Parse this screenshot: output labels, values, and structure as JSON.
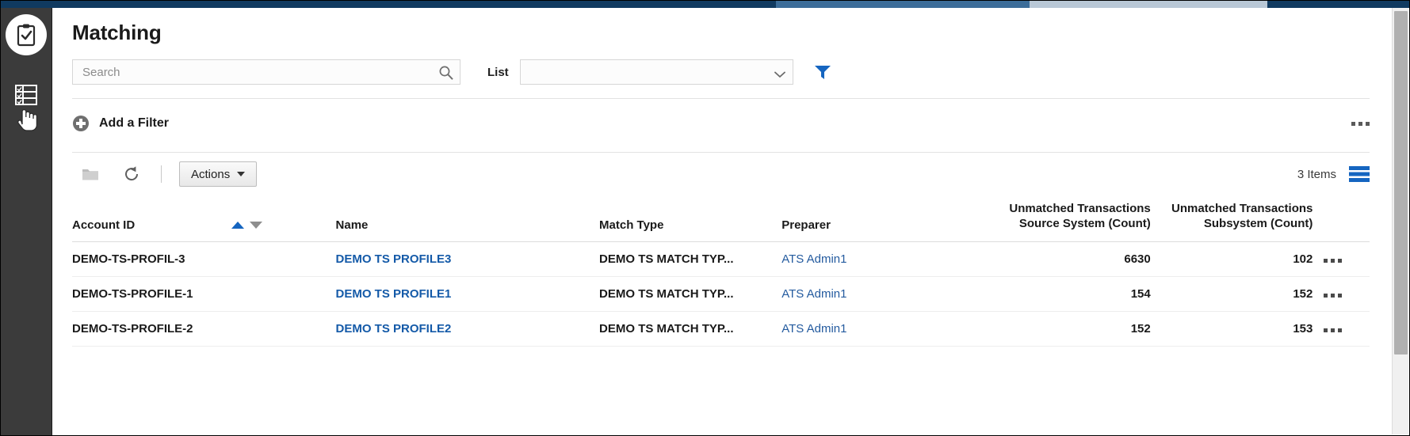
{
  "window": {
    "drag_handle": "window-drag-handle"
  },
  "rail": {
    "badge_icon": "clipboard-check-icon",
    "list_icon": "checklist-icon",
    "cursor_icon": "hand-cursor"
  },
  "header": {
    "title": "Matching"
  },
  "search": {
    "placeholder": "Search",
    "value": "",
    "icon": "search-icon"
  },
  "list_filter": {
    "label": "List",
    "value": "",
    "chevron_icon": "chevron-down-icon",
    "funnel_icon": "filter-funnel-icon"
  },
  "filter_bar": {
    "add_filter_label": "Add a Filter",
    "plus_icon": "plus-circle-icon",
    "overflow_icon": "ellipsis-icon"
  },
  "toolbar": {
    "folder_icon": "folder-icon",
    "refresh_icon": "refresh-icon",
    "actions_label": "Actions",
    "actions_caret": "caret-down-icon",
    "items_count": "3 Items",
    "view_toggle_icon": "list-view-icon"
  },
  "table": {
    "columns": [
      {
        "label": "Account ID",
        "align": "left",
        "sorted": "asc"
      },
      {
        "label": "Name",
        "align": "left"
      },
      {
        "label": "Match Type",
        "align": "left"
      },
      {
        "label": "Preparer",
        "align": "left"
      },
      {
        "label": "Unmatched Transactions Source System (Count)",
        "align": "right"
      },
      {
        "label": "Unmatched Transactions Subsystem (Count)",
        "align": "right"
      }
    ],
    "sort_asc_icon": "sort-ascending-icon",
    "sort_desc_icon": "sort-descending-icon",
    "row_menu_icon": "ellipsis-icon",
    "rows": [
      {
        "account_id": "DEMO-TS-PROFIL-3",
        "name": "DEMO TS PROFILE3",
        "match_type": "DEMO TS MATCH TYP...",
        "preparer": "ATS Admin1",
        "unmatched_source_system": "6630",
        "unmatched_subsystem": "102"
      },
      {
        "account_id": "DEMO-TS-PROFILE-1",
        "name": "DEMO TS PROFILE1",
        "match_type": "DEMO TS MATCH TYP...",
        "preparer": "ATS Admin1",
        "unmatched_source_system": "154",
        "unmatched_subsystem": "152"
      },
      {
        "account_id": "DEMO-TS-PROFILE-2",
        "name": "DEMO TS PROFILE2",
        "match_type": "DEMO TS MATCH TYP...",
        "preparer": "ATS Admin1",
        "unmatched_source_system": "152",
        "unmatched_subsystem": "153"
      }
    ]
  },
  "colors": {
    "rail": "#3b3b3b",
    "accent_blue": "#145aa8",
    "title_bar": "#103a60",
    "link": "#245b9f"
  }
}
